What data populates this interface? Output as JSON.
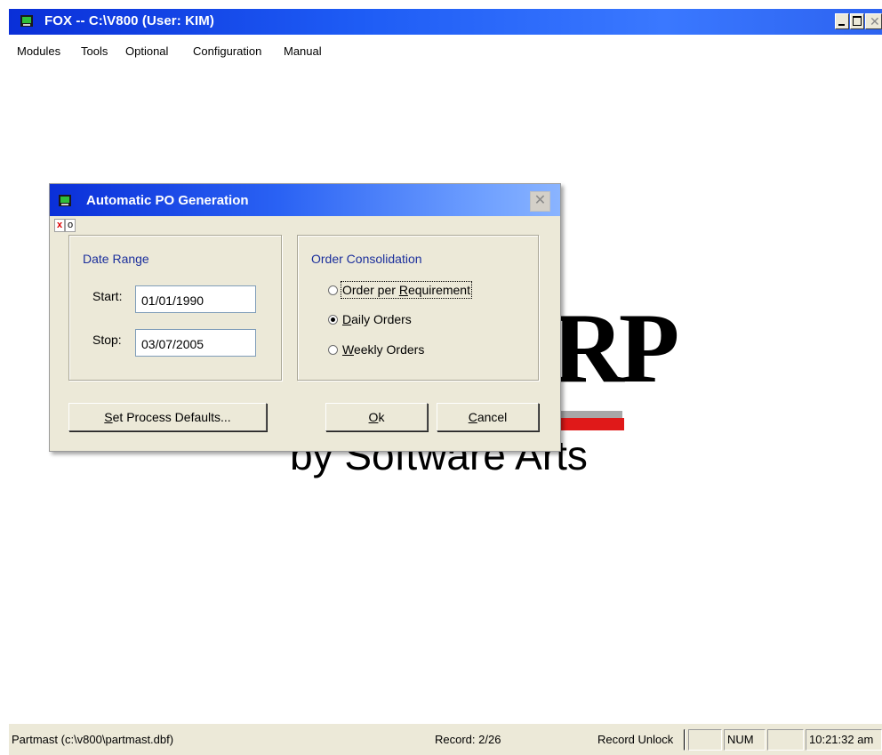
{
  "window": {
    "title": "FOX -- C:\\V800  (User: KIM)"
  },
  "menu": [
    "Modules",
    "Tools",
    "Optional",
    "Configuration",
    "Manual"
  ],
  "splash": {
    "logo_letters": "RP",
    "subtitle": "by Software Arts"
  },
  "dialog": {
    "title": "Automatic PO Generation",
    "mini_tabs": [
      "x",
      "o"
    ],
    "date_range": {
      "caption": "Date Range",
      "start_label": "Start:",
      "start_value": "01/01/1990",
      "stop_label": "Stop:",
      "stop_value": "03/07/2005"
    },
    "consolidation": {
      "caption": "Order Consolidation",
      "options": [
        {
          "pre": "Order per ",
          "key": "R",
          "post": "equirement",
          "selected": false
        },
        {
          "pre": "",
          "key": "D",
          "post": "aily Orders",
          "selected": true
        },
        {
          "pre": "",
          "key": "W",
          "post": "eekly Orders",
          "selected": false
        }
      ]
    },
    "buttons": {
      "defaults": {
        "key": "S",
        "post": "et Process Defaults..."
      },
      "ok": {
        "key": "O",
        "post": "k"
      },
      "cancel": {
        "key": "C",
        "post": "ancel"
      }
    }
  },
  "status": {
    "file": "Partmast (c:\\v800\\partmast.dbf)",
    "record": "Record: 2/26",
    "lock": "Record Unlock",
    "num": "NUM",
    "time": "10:21:32 am"
  },
  "colors": {
    "titlebar": "#0a2fd8",
    "caption": "#1b2f9c",
    "splash_red": "#e01919",
    "dialog_bg": "#ece9d8"
  }
}
